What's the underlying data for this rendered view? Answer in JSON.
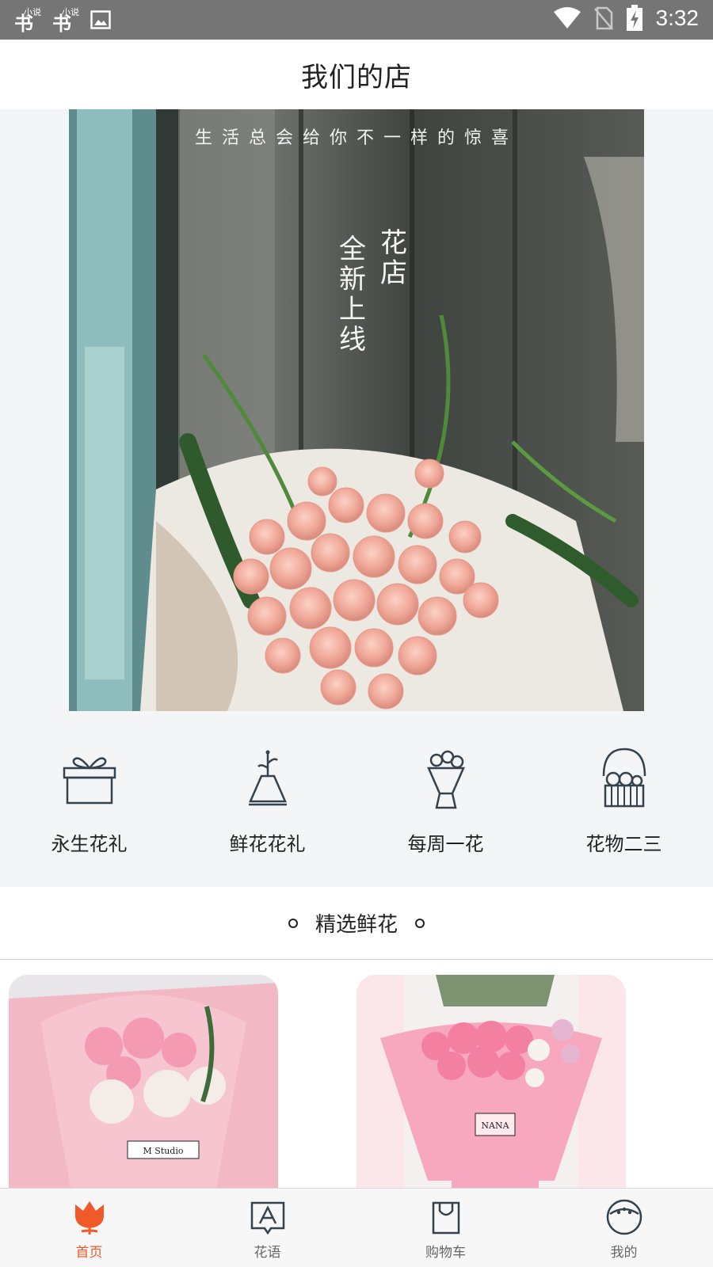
{
  "status_bar": {
    "time": "3:32",
    "apps": [
      {
        "big": "书",
        "small": "小说"
      },
      {
        "big": "书",
        "small": "小说"
      }
    ]
  },
  "header": {
    "title": "我们的店"
  },
  "banner": {
    "tagline": "生活总会给你不一样的惊喜",
    "vertical_left": "全新上线",
    "vertical_right": "花店"
  },
  "categories": [
    {
      "label": "永生花礼",
      "icon": "gift-box-icon"
    },
    {
      "label": "鲜花花礼",
      "icon": "vase-icon"
    },
    {
      "label": "每周一花",
      "icon": "bouquet-icon"
    },
    {
      "label": "花物二三",
      "icon": "flower-basket-icon"
    }
  ],
  "section": {
    "title": "精选鲜花"
  },
  "products": [
    {
      "tag": "M Studio"
    },
    {
      "tag": "NANA"
    }
  ],
  "tabbar": {
    "tabs": [
      {
        "label": "首页",
        "icon": "tulip-icon",
        "active": true
      },
      {
        "label": "花语",
        "icon": "flower-language-icon",
        "active": false
      },
      {
        "label": "购物车",
        "icon": "shopping-bag-icon",
        "active": false
      },
      {
        "label": "我的",
        "icon": "profile-face-icon",
        "active": false
      }
    ]
  },
  "colors": {
    "accent": "#f05a28",
    "status_bar": "#757575",
    "icon_stroke": "#33424d"
  }
}
